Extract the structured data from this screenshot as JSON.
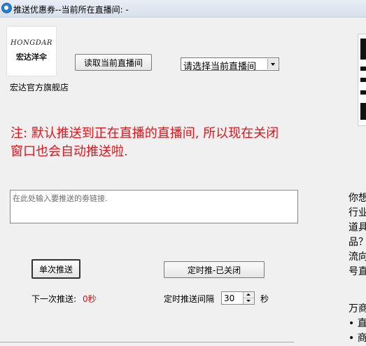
{
  "window": {
    "title": "推送优惠券--当前所在直播间: -"
  },
  "shop": {
    "logo_line1": "HONGDAR",
    "logo_line2": "宏达洋伞",
    "name": "宏达官方旗舰店"
  },
  "toolbar": {
    "read_button": "读取当前直播间",
    "room_select_value": "请选择当前直播间"
  },
  "notice": "注: 默认推送到正在直播的直播间, 所以现在关闭窗口也会自动推送啦.",
  "coupon_input": {
    "placeholder": "在此处输入要推送的劵链接.",
    "value": ""
  },
  "actions": {
    "single_push": "单次推送",
    "timed_push": "定时推-已关闭"
  },
  "status": {
    "next_push_label": "下一次推送:",
    "next_push_value": "0秒",
    "interval_label": "定时推送间隔",
    "interval_value": "30",
    "interval_unit": "秒"
  },
  "right_panel": {
    "lines": [
      "你想",
      "行业",
      "道具",
      "品？",
      "流向",
      "号直"
    ],
    "lines2": [
      "万商",
      "• 直",
      "• 商"
    ]
  }
}
